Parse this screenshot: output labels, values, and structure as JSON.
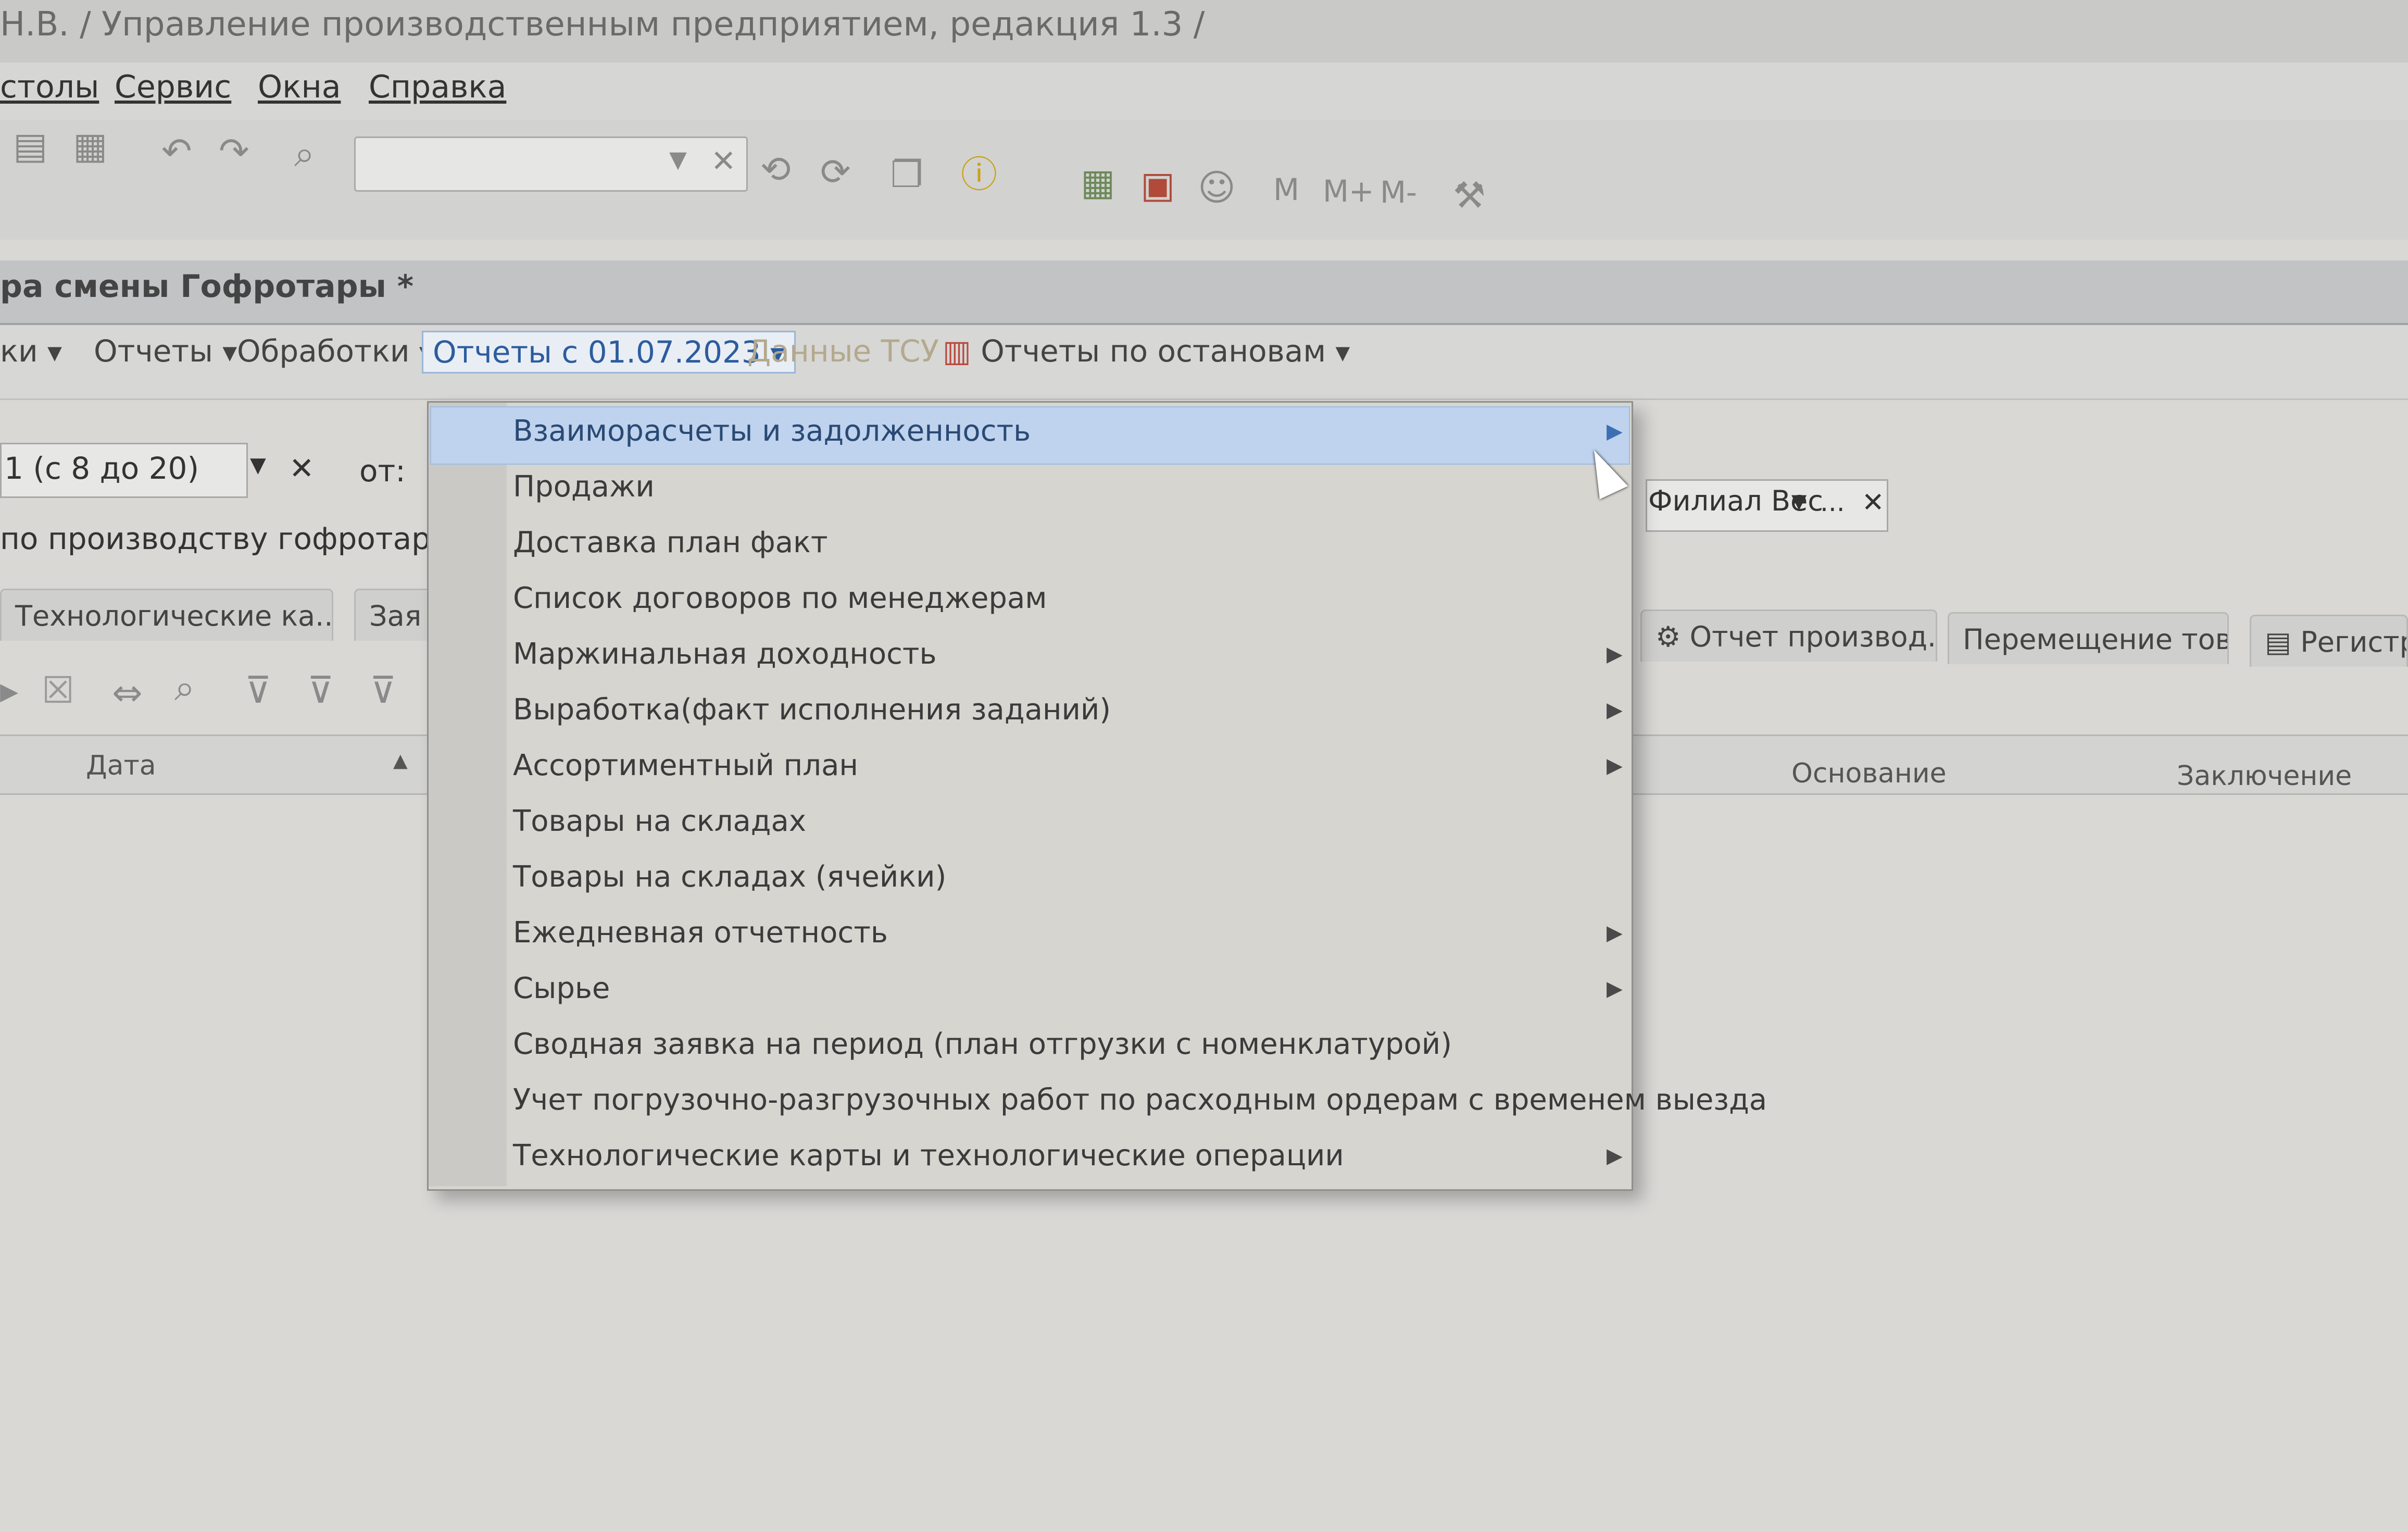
{
  "window": {
    "title": "Н.В. /  Управление производственным предприятием, редакция 1.3 /"
  },
  "menu": {
    "items": [
      "столы",
      "Сервис",
      "Окна",
      "Справка"
    ]
  },
  "toolbar": {
    "memory_labels": [
      "M",
      "M+",
      "M-"
    ]
  },
  "form": {
    "title": "ра смены Гофротары *"
  },
  "commands": {
    "items": [
      "ки",
      "Отчеты",
      "Обработки"
    ],
    "active": "Отчеты с 01.07.2023",
    "disabled": "Данные ТСУ",
    "stops": "Отчеты по остановам"
  },
  "filters": {
    "period_value": "1 (с 8 до 20)",
    "from_label": "от:",
    "description": "по производству гофротары АР",
    "branch_value": "Филиал Вес",
    "branch_more": "...",
    "clear_symbol": "✕"
  },
  "tabs": [
    "Технологические ка...",
    "Зая",
    "Отчет производ...",
    "Перемещение това...",
    "Регистра"
  ],
  "table": {
    "columns": [
      "Дата",
      "Основание",
      "Заключение"
    ]
  },
  "dropdown": {
    "items": [
      {
        "label": "Взаиморасчеты и задолженность",
        "submenu": true
      },
      {
        "label": "Продажи",
        "submenu": false
      },
      {
        "label": "Доставка план факт",
        "submenu": false
      },
      {
        "label": "Список договоров по менеджерам",
        "submenu": false
      },
      {
        "label": "Маржинальная доходность",
        "submenu": true
      },
      {
        "label": "Выработка(факт исполнения заданий)",
        "submenu": true
      },
      {
        "label": "Ассортиментный план",
        "submenu": true
      },
      {
        "label": "Товары на складах",
        "submenu": false
      },
      {
        "label": "Товары на складах (ячейки)",
        "submenu": false
      },
      {
        "label": "Ежедневная отчетность",
        "submenu": true
      },
      {
        "label": "Сырье",
        "submenu": true
      },
      {
        "label": "Сводная заявка на период (план отгрузки с номенклатурой)",
        "submenu": false
      },
      {
        "label": "Учет погрузочно-разгрузочных работ по расходным ордерам с временем выезда",
        "submenu": false
      },
      {
        "label": "Технологические карты и технологические операции",
        "submenu": true
      }
    ]
  },
  "colors": {
    "highlight": "#bfd3ee",
    "active_command": "#2c5c9e",
    "background": "#d9d8d5"
  }
}
